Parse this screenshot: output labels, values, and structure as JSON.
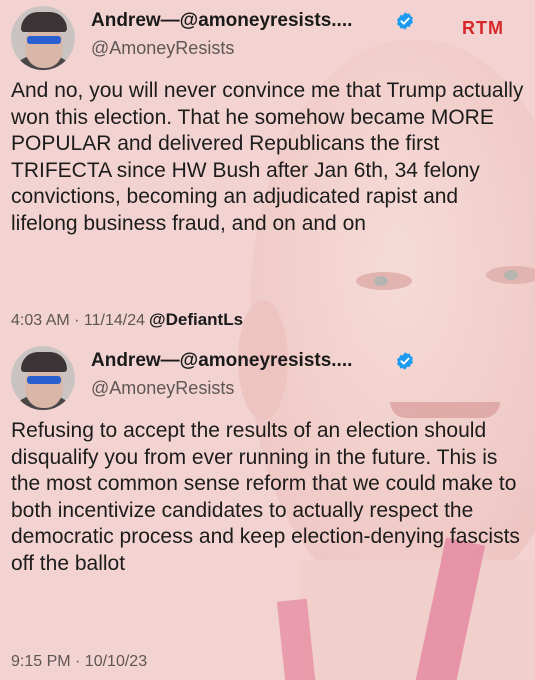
{
  "logo": "RTM",
  "tweets": [
    {
      "name": "Andrew—@amoneyresists....",
      "handle": "@AmoneyResists",
      "text": "And no, you will never convince me that Trump actually won this election. That he somehow became MORE POPULAR and delivered Republicans the first TRIFECTA since HW Bush after Jan 6th, 34 felony convictions, becoming an adjudicated rapist and lifelong business fraud, and on and on",
      "timestamp": "4:03 AM · 11/14/24",
      "credit": "@DefiantLs"
    },
    {
      "name": "Andrew—@amoneyresists....",
      "handle": "@AmoneyResists",
      "text": "Refusing to accept the results of an election should disqualify you from ever running in the future. This is the most common sense reform that we could make to both incentivize candidates to actually respect the democratic process and keep election-denying fascists off the ballot",
      "timestamp": "9:15 PM · 10/10/23"
    }
  ],
  "colors": {
    "background": "#f3d3d1",
    "verified": "#1d9bf0",
    "logo": "#d62828"
  }
}
